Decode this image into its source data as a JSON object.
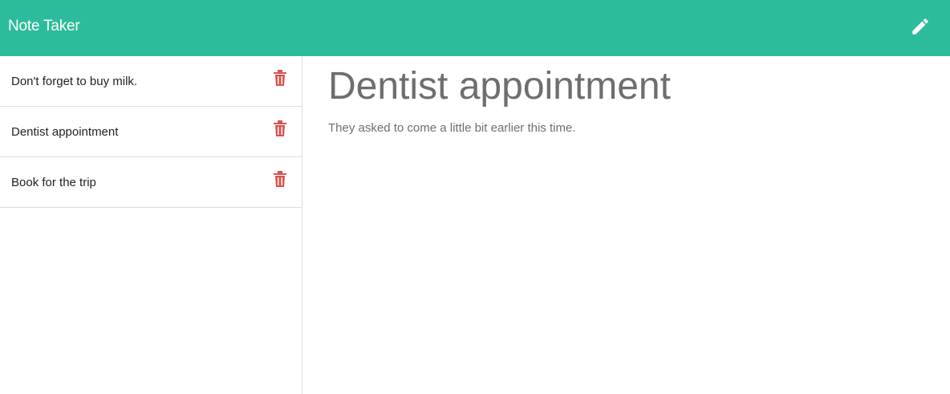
{
  "app": {
    "title": "Note Taker",
    "accent_color": "#2dbc9b",
    "new_note_icon": "pencil-icon"
  },
  "sidebar": {
    "notes": [
      {
        "title": "Don't forget to buy milk.",
        "action_icon": "trash-icon"
      },
      {
        "title": "Dentist appointment",
        "action_icon": "trash-icon"
      },
      {
        "title": "Book for the trip",
        "action_icon": "trash-icon"
      }
    ],
    "delete_color": "#d9534f"
  },
  "main": {
    "active_note": {
      "title": "Dentist appointment",
      "text": "They asked to come a little bit earlier this time."
    }
  }
}
